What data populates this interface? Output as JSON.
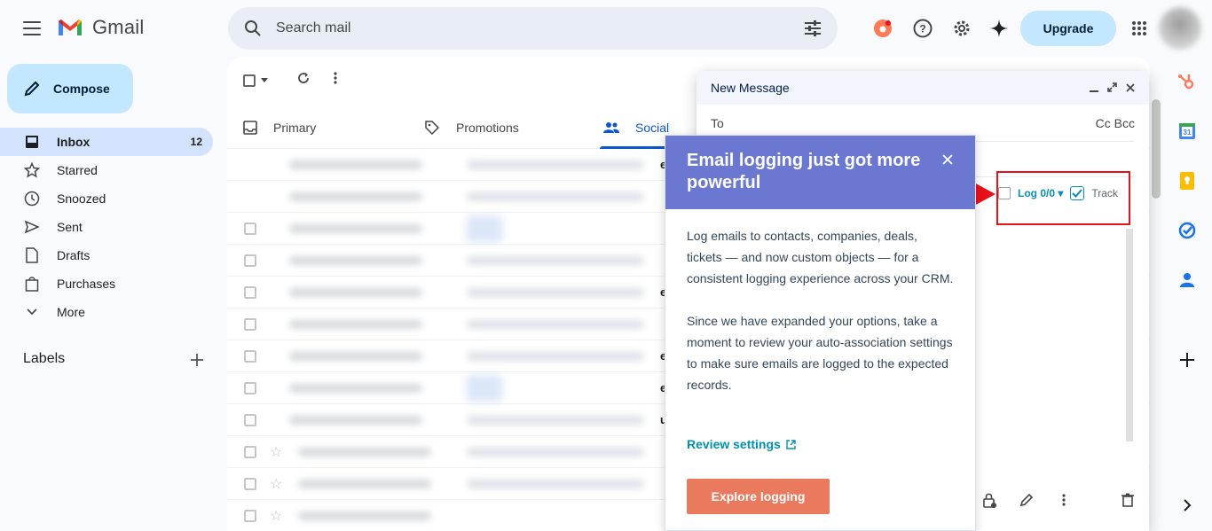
{
  "app": {
    "name": "Gmail"
  },
  "search": {
    "placeholder": "Search mail"
  },
  "header": {
    "upgrade_label": "Upgrade"
  },
  "compose_button": {
    "label": "Compose"
  },
  "nav": {
    "items": [
      {
        "label": "Inbox",
        "count": "12",
        "icon": "inbox-icon"
      },
      {
        "label": "Starred",
        "icon": "star-icon"
      },
      {
        "label": "Snoozed",
        "icon": "clock-icon"
      },
      {
        "label": "Sent",
        "icon": "send-icon"
      },
      {
        "label": "Drafts",
        "icon": "draft-icon"
      },
      {
        "label": "Purchases",
        "icon": "bag-icon"
      },
      {
        "label": "More",
        "icon": "chevron-down-icon"
      }
    ],
    "labels_header": "Labels"
  },
  "tabs": [
    {
      "label": "Primary"
    },
    {
      "label": "Promotions"
    },
    {
      "label": "Social"
    }
  ],
  "mail_rows_visible_fragments": [
    "e",
    "",
    "",
    "e",
    "",
    "e",
    "e",
    "e",
    "u"
  ],
  "compose_window": {
    "title": "New Message",
    "to_label": "To",
    "cc_bcc": "Cc Bcc",
    "log_label": "Log 0/0",
    "track_label": "Track"
  },
  "popover": {
    "title": "Email logging just got more powerful",
    "paragraph1": "Log emails to contacts, companies, deals, tickets — and now custom objects — for a consistent logging experience across your CRM.",
    "paragraph2": "Since we have expanded your options, take a moment to review your auto-association settings to make sure emails are logged to the expected records.",
    "link_label": "Review settings",
    "button_label": "Explore logging"
  },
  "colors": {
    "popover_header": "#6a78d1",
    "popover_button": "#ea7a5e",
    "link": "#0091ae",
    "highlight": "#e8101a",
    "active_nav": "#d3e3fd",
    "accent_blue": "#0b57d0"
  }
}
